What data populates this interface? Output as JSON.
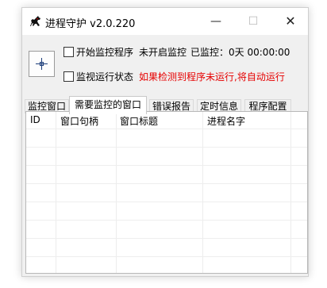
{
  "window": {
    "title": "进程守护 v2.0.220",
    "min_glyph": "—",
    "max_glyph": "☐",
    "close_glyph": "✕"
  },
  "controls": {
    "start_monitor_label": "开始监控程序",
    "monitor_state": "未开启监控",
    "elapsed_label": "已监控：",
    "elapsed_value": "0天 00:00:00",
    "monitor_status_label": "监视运行状态",
    "auto_run_notice": "如果检测到程序未运行,将自动运行"
  },
  "tabs": [
    {
      "label": "监控窗口"
    },
    {
      "label": "需要监控的窗口"
    },
    {
      "label": "错误报告"
    },
    {
      "label": "定时信息"
    },
    {
      "label": "程序配置"
    }
  ],
  "table": {
    "columns": [
      "ID",
      "窗口句柄",
      "窗口标题",
      "进程名字"
    ],
    "rows": []
  },
  "icons": {
    "app": "horse-icon",
    "target": "crosshair-icon"
  },
  "colors": {
    "warning_text": "#e60000"
  }
}
